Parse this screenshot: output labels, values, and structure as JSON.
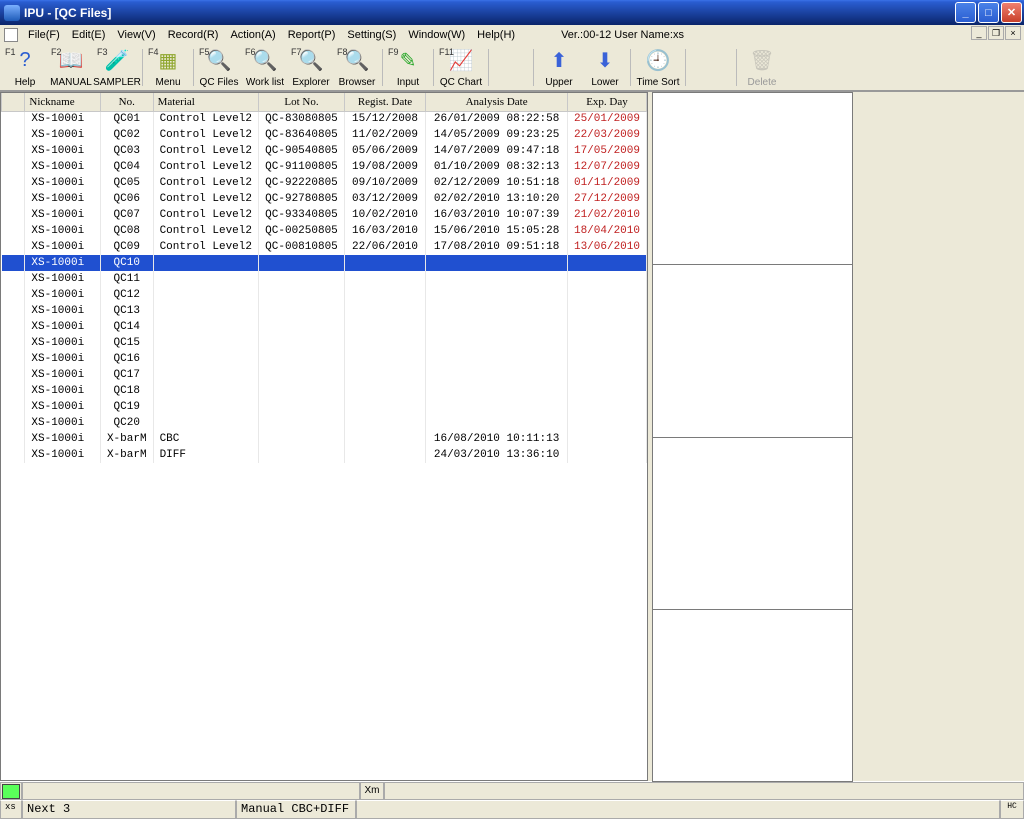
{
  "window": {
    "title": "IPU - [QC Files]",
    "version_line": "Ver.:00-12 User Name:xs"
  },
  "menu": {
    "items": [
      "File(F)",
      "Edit(E)",
      "View(V)",
      "Record(R)",
      "Action(A)",
      "Report(P)",
      "Setting(S)",
      "Window(W)",
      "Help(H)"
    ]
  },
  "toolbar": {
    "help": {
      "fkey": "F1",
      "label": "Help",
      "glyph": "?"
    },
    "manual": {
      "fkey": "F2",
      "label": "MANUAL",
      "glyph": "📖"
    },
    "sampler": {
      "fkey": "F3",
      "label": "SAMPLER",
      "glyph": "🧪"
    },
    "menu": {
      "fkey": "F4",
      "label": "Menu",
      "glyph": "▦"
    },
    "qcfiles": {
      "fkey": "F5",
      "label": "QC Files",
      "glyph": "🔍"
    },
    "worklist": {
      "fkey": "F6",
      "label": "Work list",
      "glyph": "🔍"
    },
    "explorer": {
      "fkey": "F7",
      "label": "Explorer",
      "glyph": "🔍"
    },
    "browser": {
      "fkey": "F8",
      "label": "Browser",
      "glyph": "🔍"
    },
    "input": {
      "fkey": "F9",
      "label": "Input",
      "glyph": "✎"
    },
    "qcchart": {
      "fkey": "F11",
      "label": "QC Chart",
      "glyph": "📈"
    },
    "upper": {
      "fkey": "",
      "label": "Upper",
      "glyph": "⬆"
    },
    "lower": {
      "fkey": "",
      "label": "Lower",
      "glyph": "⬇"
    },
    "timesort": {
      "fkey": "",
      "label": "Time Sort",
      "glyph": "🕘"
    },
    "delete": {
      "fkey": "",
      "label": "Delete",
      "glyph": "🗑"
    }
  },
  "table": {
    "headers": {
      "blank": "",
      "nickname": "Nickname",
      "no": "No.",
      "material": "Material",
      "lot": "Lot No.",
      "regist": "Regist. Date",
      "analysis": "Analysis Date",
      "exp": "Exp. Day"
    },
    "selected_index": 9,
    "rows": [
      {
        "nickname": "XS-1000i",
        "no": "QC01",
        "material": "Control Level2",
        "lot": "QC-83080805",
        "regist": "15/12/2008",
        "analysis": "26/01/2009 08:22:58",
        "exp": "25/01/2009"
      },
      {
        "nickname": "XS-1000i",
        "no": "QC02",
        "material": "Control Level2",
        "lot": "QC-83640805",
        "regist": "11/02/2009",
        "analysis": "14/05/2009 09:23:25",
        "exp": "22/03/2009"
      },
      {
        "nickname": "XS-1000i",
        "no": "QC03",
        "material": "Control Level2",
        "lot": "QC-90540805",
        "regist": "05/06/2009",
        "analysis": "14/07/2009 09:47:18",
        "exp": "17/05/2009"
      },
      {
        "nickname": "XS-1000i",
        "no": "QC04",
        "material": "Control Level2",
        "lot": "QC-91100805",
        "regist": "19/08/2009",
        "analysis": "01/10/2009 08:32:13",
        "exp": "12/07/2009"
      },
      {
        "nickname": "XS-1000i",
        "no": "QC05",
        "material": "Control Level2",
        "lot": "QC-92220805",
        "regist": "09/10/2009",
        "analysis": "02/12/2009 10:51:18",
        "exp": "01/11/2009"
      },
      {
        "nickname": "XS-1000i",
        "no": "QC06",
        "material": "Control Level2",
        "lot": "QC-92780805",
        "regist": "03/12/2009",
        "analysis": "02/02/2010 13:10:20",
        "exp": "27/12/2009"
      },
      {
        "nickname": "XS-1000i",
        "no": "QC07",
        "material": "Control Level2",
        "lot": "QC-93340805",
        "regist": "10/02/2010",
        "analysis": "16/03/2010 10:07:39",
        "exp": "21/02/2010"
      },
      {
        "nickname": "XS-1000i",
        "no": "QC08",
        "material": "Control Level2",
        "lot": "QC-00250805",
        "regist": "16/03/2010",
        "analysis": "15/06/2010 15:05:28",
        "exp": "18/04/2010"
      },
      {
        "nickname": "XS-1000i",
        "no": "QC09",
        "material": "Control Level2",
        "lot": "QC-00810805",
        "regist": "22/06/2010",
        "analysis": "17/08/2010 09:51:18",
        "exp": "13/06/2010"
      },
      {
        "nickname": "XS-1000i",
        "no": "QC10",
        "material": "",
        "lot": "",
        "regist": "",
        "analysis": "",
        "exp": ""
      },
      {
        "nickname": "XS-1000i",
        "no": "QC11",
        "material": "",
        "lot": "",
        "regist": "",
        "analysis": "",
        "exp": ""
      },
      {
        "nickname": "XS-1000i",
        "no": "QC12",
        "material": "",
        "lot": "",
        "regist": "",
        "analysis": "",
        "exp": ""
      },
      {
        "nickname": "XS-1000i",
        "no": "QC13",
        "material": "",
        "lot": "",
        "regist": "",
        "analysis": "",
        "exp": ""
      },
      {
        "nickname": "XS-1000i",
        "no": "QC14",
        "material": "",
        "lot": "",
        "regist": "",
        "analysis": "",
        "exp": ""
      },
      {
        "nickname": "XS-1000i",
        "no": "QC15",
        "material": "",
        "lot": "",
        "regist": "",
        "analysis": "",
        "exp": ""
      },
      {
        "nickname": "XS-1000i",
        "no": "QC16",
        "material": "",
        "lot": "",
        "regist": "",
        "analysis": "",
        "exp": ""
      },
      {
        "nickname": "XS-1000i",
        "no": "QC17",
        "material": "",
        "lot": "",
        "regist": "",
        "analysis": "",
        "exp": ""
      },
      {
        "nickname": "XS-1000i",
        "no": "QC18",
        "material": "",
        "lot": "",
        "regist": "",
        "analysis": "",
        "exp": ""
      },
      {
        "nickname": "XS-1000i",
        "no": "QC19",
        "material": "",
        "lot": "",
        "regist": "",
        "analysis": "",
        "exp": ""
      },
      {
        "nickname": "XS-1000i",
        "no": "QC20",
        "material": "",
        "lot": "",
        "regist": "",
        "analysis": "",
        "exp": ""
      },
      {
        "nickname": "XS-1000i",
        "no": "X-barM",
        "material": "CBC",
        "lot": "",
        "regist": "",
        "analysis": "16/08/2010 10:11:13",
        "exp": ""
      },
      {
        "nickname": "XS-1000i",
        "no": "X-barM",
        "material": "DIFF",
        "lot": "",
        "regist": "",
        "analysis": "24/03/2010 13:36:10",
        "exp": ""
      }
    ]
  },
  "status": {
    "xm_label": "Xm",
    "xs_label": "xs",
    "next_label": "Next 3",
    "mode_label": "Manual CBC+DIFF",
    "corner": "HC"
  }
}
